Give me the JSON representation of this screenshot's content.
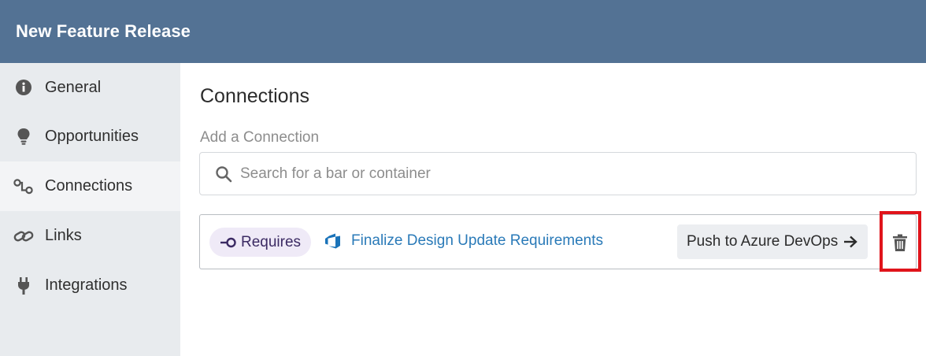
{
  "header": {
    "title": "New Feature Release"
  },
  "sidebar": {
    "items": [
      {
        "label": "General",
        "icon": "info-icon"
      },
      {
        "label": "Opportunities",
        "icon": "lightbulb-icon"
      },
      {
        "label": "Connections",
        "icon": "connections-icon",
        "active": true
      },
      {
        "label": "Links",
        "icon": "link-icon"
      },
      {
        "label": "Integrations",
        "icon": "plug-icon"
      }
    ]
  },
  "main": {
    "title": "Connections",
    "add_label": "Add a Connection",
    "search": {
      "placeholder": "Search for a bar or container",
      "value": ""
    },
    "connection": {
      "relation": "Requires",
      "record": "Finalize Design Update Requirements",
      "push_label": "Push to Azure DevOps",
      "delete_icon": "trash-icon"
    }
  },
  "colors": {
    "header": "#537294",
    "sidebar": "#e8ebee",
    "link": "#2a7ab8",
    "pill": "#efeaf7",
    "highlight": "#e0141b"
  }
}
